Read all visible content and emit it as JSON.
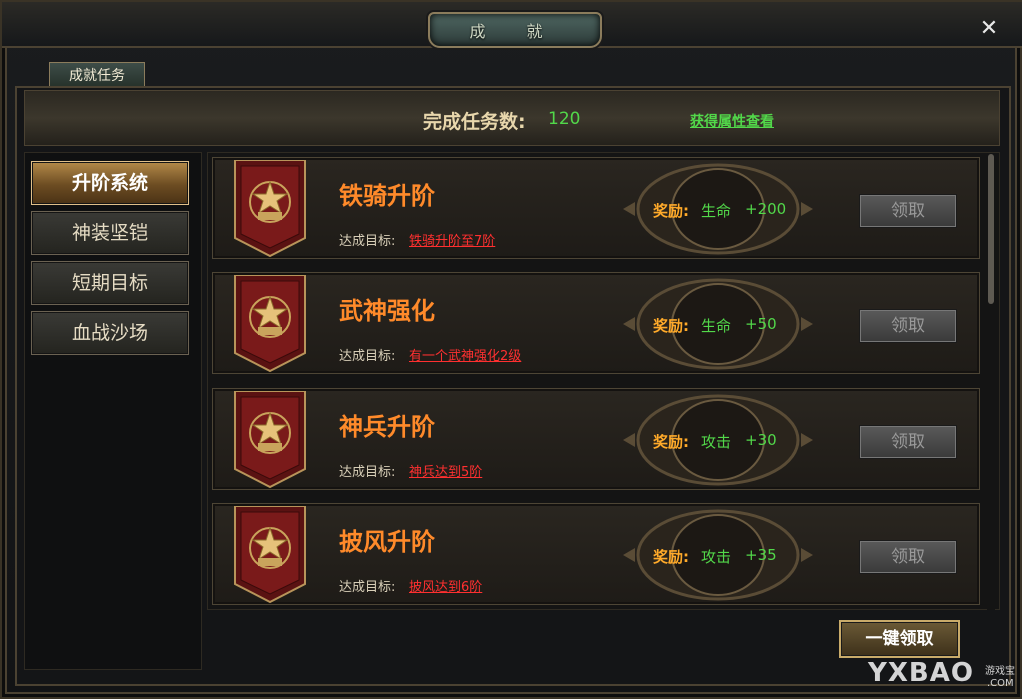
{
  "window": {
    "title": "成 就",
    "close_symbol": "✕"
  },
  "tabs": [
    {
      "label": "成就任务"
    }
  ],
  "stats": {
    "label": "完成任务数:",
    "value": "120",
    "attr_link": "获得属性查看"
  },
  "sidebar": {
    "items": [
      {
        "label": "升阶系统",
        "active": true
      },
      {
        "label": "神装坚铠",
        "active": false
      },
      {
        "label": "短期目标",
        "active": false
      },
      {
        "label": "血战沙场",
        "active": false
      }
    ]
  },
  "tasks": [
    {
      "name": "铁骑升阶",
      "goal_label": "达成目标:",
      "goal": "铁骑升阶至7阶",
      "reward_label": "奖励:",
      "reward_attr": "生命",
      "reward_value": "+200",
      "claim_label": "领取"
    },
    {
      "name": "武神强化",
      "goal_label": "达成目标:",
      "goal": "有一个武神强化2级",
      "reward_label": "奖励:",
      "reward_attr": "生命",
      "reward_value": "+50",
      "claim_label": "领取"
    },
    {
      "name": "神兵升阶",
      "goal_label": "达成目标:",
      "goal": "神兵达到5阶",
      "reward_label": "奖励:",
      "reward_attr": "攻击",
      "reward_value": "+30",
      "claim_label": "领取"
    },
    {
      "name": "披风升阶",
      "goal_label": "达成目标:",
      "goal": "披风达到6阶",
      "reward_label": "奖励:",
      "reward_attr": "攻击",
      "reward_value": "+35",
      "claim_label": "领取"
    }
  ],
  "footer": {
    "claim_all_label": "一键领取"
  },
  "watermark": {
    "text": "YXBAO",
    "small": "游戏宝",
    "small2": ".COM"
  },
  "colors": {
    "accent_orange": "#ff8a2a",
    "reward_green": "#52d84a",
    "goal_red": "#ff3030",
    "gold": "#c9ab6a"
  }
}
